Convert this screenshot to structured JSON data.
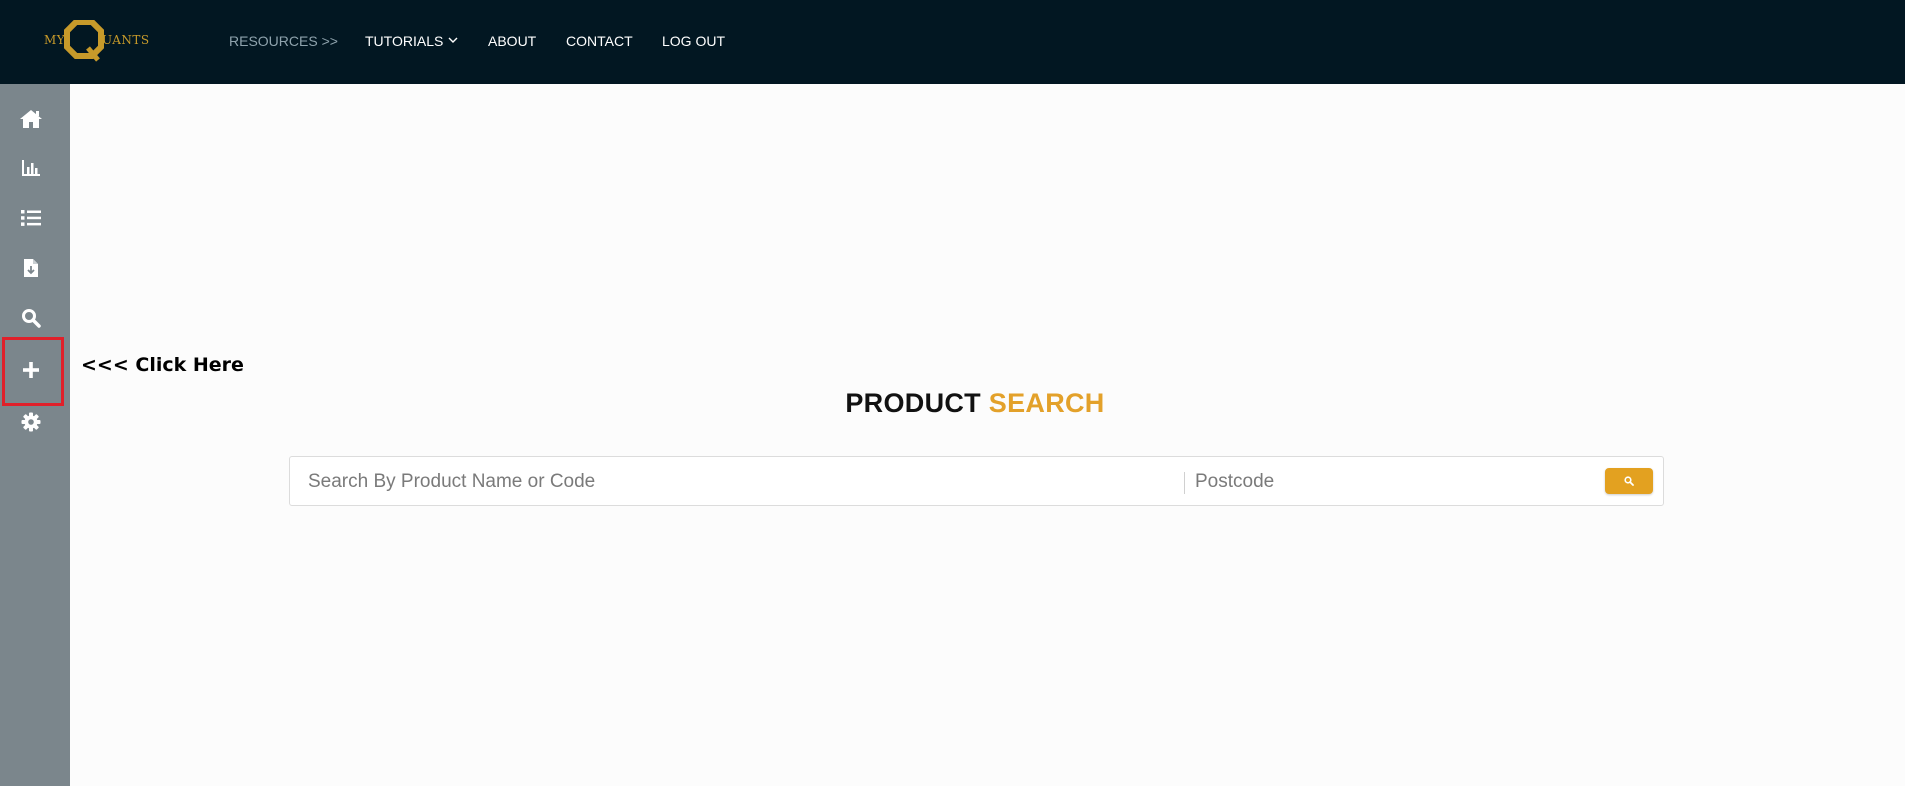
{
  "header": {
    "logo": {
      "left_text": "MY",
      "right_text": "UANTS"
    },
    "nav": [
      {
        "label": "RESOURCES >>"
      },
      {
        "label": "TUTORIALS"
      },
      {
        "label": "ABOUT"
      },
      {
        "label": "CONTACT"
      },
      {
        "label": "LOG OUT"
      }
    ]
  },
  "sidebar": {
    "items": [
      {
        "icon": "home-icon"
      },
      {
        "icon": "bar-chart-icon"
      },
      {
        "icon": "list-icon"
      },
      {
        "icon": "file-download-icon"
      },
      {
        "icon": "search-icon"
      },
      {
        "icon": "plus-icon",
        "highlighted": true
      },
      {
        "icon": "gear-icon"
      }
    ]
  },
  "callout": {
    "text": "<<< Click Here"
  },
  "main": {
    "title_part1": "PRODUCT",
    "title_part2": "SEARCH",
    "search": {
      "product_placeholder": "Search By Product Name or Code",
      "postcode_placeholder": "Postcode"
    }
  },
  "colors": {
    "header_bg": "#021722",
    "sidebar_bg": "#7b868c",
    "accent": "#e3a12a",
    "highlight_border": "#e0202a"
  }
}
